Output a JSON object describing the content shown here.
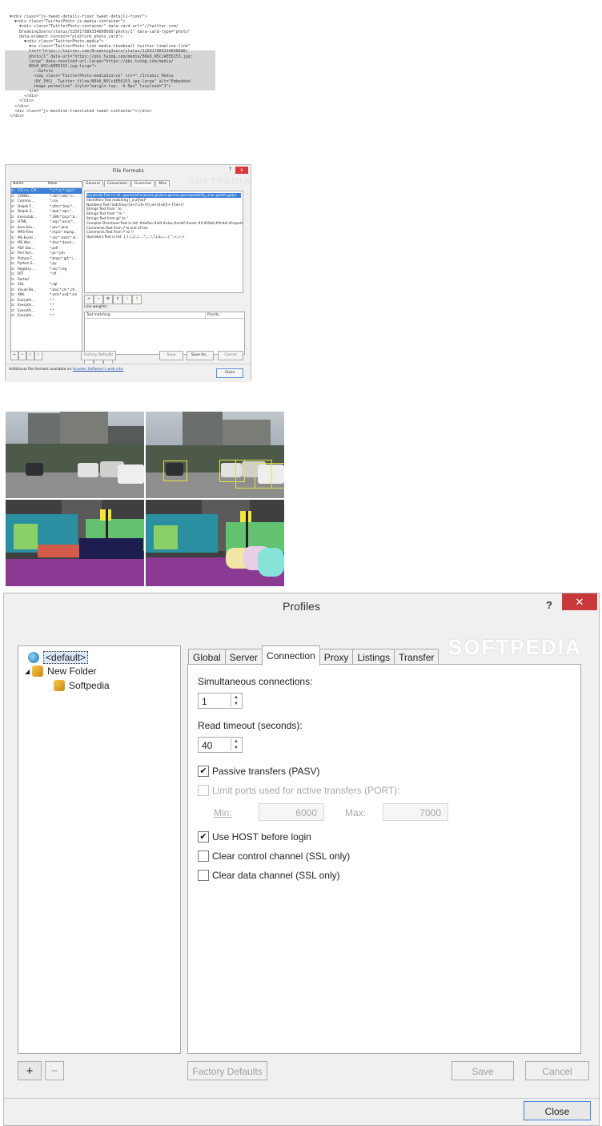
{
  "code_panel": {
    "lines": [
      "▼<div class=\"js-tweet-details-fixer tweet-details-fixer\">",
      "  ▼<div class=\"TwitterPhoto js-media-container\">",
      "    ▼<div class=\"TwitterPhoto-container\" data-card-url=\"//twitter.com/",
      "    Breaking3zero/status/525017889334898688/photo/1\" data-card-type=\"photo\"",
      "    data-element-context=\"platform_photo_card\">",
      "      ▼<div class=\"TwitterPhoto-media\">",
      "        ▼<a class=\"TwitterPhoto-link media-thumbnail twitter-timeline-link\"",
      "        href=\"https://twitter.com/Breaking3zero/status/525017889334898688/",
      "        photo/1\" data-url=\"https://pbs.twimg.com/media/B0k8_N5CcAEE6153.jpg:",
      "        large\" data-resolved-url-large=\"https://pbs.twimg.com/media/",
      "        B0k8_N5CcAEE6153.jpg:large\">",
      "          ::before",
      "          <img class=\"TwitterPhoto-mediaSource\" src=\"./Islamic_Media",
      "          (BY_IHS)_ Twitter_files/B0k8_N5CcAEE6153.jpg-large\" alt=\"Embedded",
      "          image permalink\" style=\"margin-top: -6.0px\" lazyload=\"1\">",
      "        </a>",
      "      </div>",
      "    </div>",
      "  </div>",
      "  <div class=\"js-machine-translated-tweet-container\"></div>",
      "</div>"
    ]
  },
  "file_formats": {
    "title": "File Formats",
    "help": "?",
    "close": "x",
    "watermark": "SOFTPEDIA",
    "list_headers": [
      "Name",
      "Mask"
    ],
    "rows": [
      {
        "name": "C/C++, C#...",
        "mask": "*.c;*.cc;*.cpp;*...",
        "selected": true
      },
      {
        "name": "COBOL ...",
        "mask": "*.cbl;*.cob;*.c..."
      },
      {
        "name": "Comma ...",
        "mask": "*.csv"
      },
      {
        "name": "Delphi F...",
        "mask": "*.dfm;*.fmx;*..."
      },
      {
        "name": "Delphi S...",
        "mask": "*.dpk;*.dpr;*..."
      },
      {
        "name": "Executab...",
        "mask": "*.386;*.bcp;*.b..."
      },
      {
        "name": "HTML",
        "mask": "*.asp;*.ascx;*..."
      },
      {
        "name": "Java Sou...",
        "mask": "*.jav;*.java"
      },
      {
        "name": "MP3 Files",
        "mask": "*.mp3;*.mpeg..."
      },
      {
        "name": "MS Excel...",
        "mask": "*.xls;*.xlsm;*.xl..."
      },
      {
        "name": "MS Wor...",
        "mask": "*.doc;*.docm;..."
      },
      {
        "name": "PDF Doc...",
        "mask": "*.pdf"
      },
      {
        "name": "Perl Scri...",
        "mask": "*.pl;*.pm"
      },
      {
        "name": "Picture F...",
        "mask": "*.bmp;*.gif;*.i..."
      },
      {
        "name": "Python S...",
        "mask": "*.py"
      },
      {
        "name": "Registry ...",
        "mask": "*.inc;*.reg"
      },
      {
        "name": "RTF",
        "mask": "*.rtf"
      },
      {
        "name": "Sorted",
        "mask": ""
      },
      {
        "name": "SQL",
        "mask": "*.sql"
      },
      {
        "name": "Visual Ba...",
        "mask": "*.bas;*.cls;*.ctl..."
      },
      {
        "name": "XML",
        "mask": "*.xml;*.xsd;*.xsl"
      },
      {
        "name": "Everythi...",
        "mask": "*.*"
      },
      {
        "name": "Everythi...",
        "mask": "*.*"
      },
      {
        "name": "Everythi...",
        "mask": "*.*"
      },
      {
        "name": "Everythi...",
        "mask": "*.*"
      }
    ],
    "tabs": [
      "General",
      "Conversion",
      "Grammar",
      "Misc"
    ],
    "active_tab": "Grammar",
    "grammar_lines": [
      "Keywords:Text in list: @autoreleasepool,@catch,@class,@compatibility_alias,@defs,@dyr",
      "Identifiers:Text matching [_a-z][\\w]*",
      "Numbers:Text matching (\\d+(\\.\\d+)?|\\.\\d+)([eE][+-]?\\d+)?",
      "Strings:Text from ' to '",
      "Strings:Text from \" to \"",
      "Strings:Text from @\" to \"",
      "Compiler Directives:Text in list: #define,#elif,#else,#endif,#error,#if,#ifdef,#ifndef,#import",
      "Comments:Text from // to end of line",
      "Comments:Text from /* to */",
      "Operators:Text in list: {,},(,),[,],...,*,;,:,!,?,|,&,=,-,/,^,<,>,<"
    ],
    "line_weights_label": "Line weights:",
    "lw_headers": [
      "Text matching",
      "Priority"
    ],
    "factory_defaults": "Factory Defaults",
    "save": "Save",
    "save_as": "Save As...",
    "cancel": "Cancel",
    "footer_text": "Additional file formats available on",
    "footer_link": "Scooter Software's web site.",
    "close_btn": "Close"
  },
  "profiles": {
    "title": "Profiles",
    "help": "?",
    "close": "✕",
    "watermark": "SOFTPEDIA",
    "tree": [
      {
        "label": "<default>",
        "level": 0,
        "selected": true
      },
      {
        "label": "New Folder",
        "level": 0
      },
      {
        "label": "Softpedia",
        "level": 1
      }
    ],
    "tabs": [
      "Global",
      "Server",
      "Connection",
      "Proxy",
      "Listings",
      "Transfer"
    ],
    "active_tab": "Connection",
    "simultaneous_label": "Simultaneous connections:",
    "simultaneous_value": "1",
    "timeout_label": "Read timeout (seconds):",
    "timeout_value": "40",
    "passive_label": "Passive transfers (PASV)",
    "passive_checked": true,
    "limit_ports_label": "Limit ports used for active transfers (PORT):",
    "min_label": "Min:",
    "min_value": "6000",
    "max_label": "Max:",
    "max_value": "7000",
    "use_host_label": "Use HOST before login",
    "use_host_checked": true,
    "clear_control_label": "Clear control channel (SSL only)",
    "clear_data_label": "Clear data channel (SSL only)",
    "add": "+",
    "remove": "−",
    "factory_defaults": "Factory Defaults",
    "save": "Save",
    "cancel": "Cancel",
    "close_btn": "Close"
  }
}
